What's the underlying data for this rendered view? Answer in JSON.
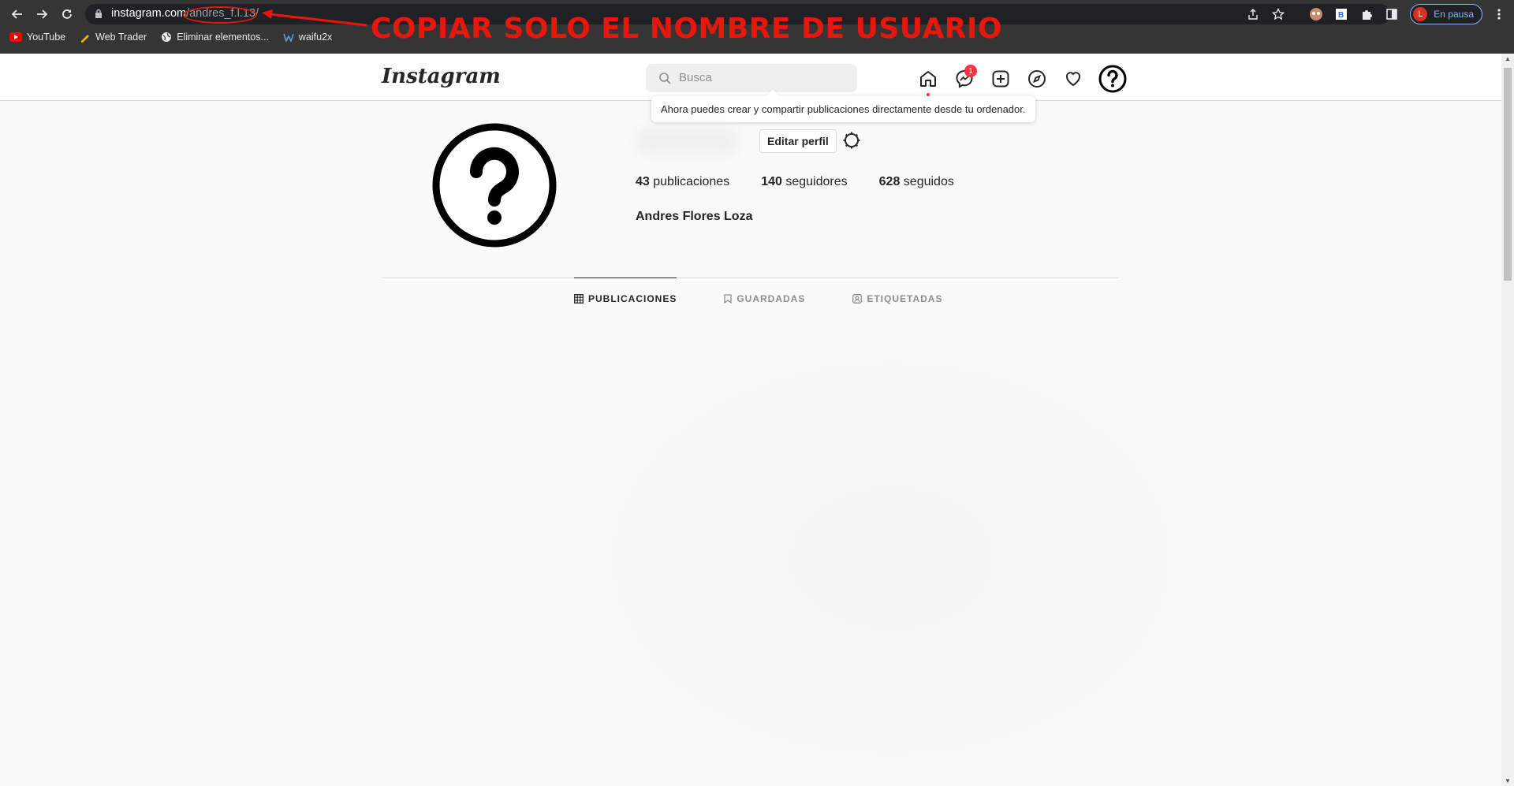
{
  "browser": {
    "url_host": "instagram.com",
    "url_path": "/andres_f.l.13/",
    "profile_status": "En pausa",
    "profile_initial": "L",
    "bookmarks": [
      {
        "label": "YouTube",
        "icon": "youtube-icon"
      },
      {
        "label": "Web Trader",
        "icon": "pen-icon"
      },
      {
        "label": "Eliminar elementos...",
        "icon": "globe-icon"
      },
      {
        "label": "waifu2x",
        "icon": "w-icon"
      }
    ]
  },
  "annotation": {
    "text": "COPIAR SOLO EL NOMBRE DE USUARIO",
    "color": "#e8170e"
  },
  "instagram": {
    "logo": "Instagram",
    "search_placeholder": "Busca",
    "messages_badge": "1",
    "tooltip": "Ahora puedes crear y compartir publicaciones directamente desde tu ordenador.",
    "nav_icons": [
      "home-icon",
      "messenger-icon",
      "new-post-icon",
      "explore-icon",
      "activity-heart-icon",
      "profile-help-icon"
    ]
  },
  "profile": {
    "edit_button": "Editar perfil",
    "posts_count": "43",
    "posts_label": "publicaciones",
    "followers_count": "140",
    "followers_label": "seguidores",
    "following_count": "628",
    "following_label": "seguidos",
    "full_name": "Andres Flores Loza"
  },
  "tabs": [
    {
      "label": "PUBLICACIONES",
      "icon": "grid-icon",
      "active": true
    },
    {
      "label": "GUARDADAS",
      "icon": "bookmark-icon",
      "active": false
    },
    {
      "label": "ETIQUETADAS",
      "icon": "tagged-icon",
      "active": false
    }
  ]
}
